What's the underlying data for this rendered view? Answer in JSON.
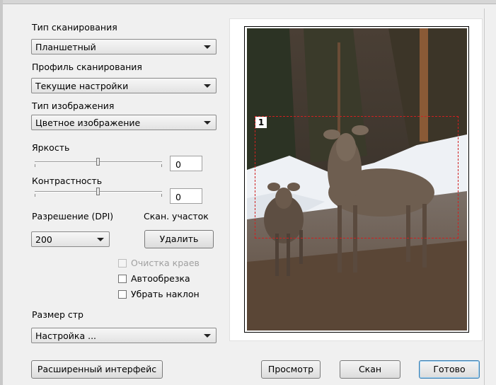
{
  "scan_type": {
    "label": "Тип сканирования",
    "value": "Планшетный"
  },
  "scan_profile": {
    "label": "Профиль сканирования",
    "value": "Текущие настройки"
  },
  "image_type": {
    "label": "Тип изображения",
    "value": "Цветное изображение"
  },
  "brightness": {
    "label": "Яркость",
    "value": "0"
  },
  "contrast": {
    "label": "Контрастность",
    "value": "0"
  },
  "resolution": {
    "label": "Разрешение (DPI)",
    "value": "200"
  },
  "scan_area": {
    "label": "Скан. участок",
    "delete_button": "Удалить"
  },
  "options": {
    "edge_cleanup": {
      "label": "Очистка краев",
      "enabled": false,
      "checked": false
    },
    "auto_crop": {
      "label": "Автообрезка",
      "enabled": true,
      "checked": false
    },
    "deskew": {
      "label": "Убрать наклон",
      "enabled": true,
      "checked": false
    }
  },
  "page_size": {
    "label": "Размер стр",
    "value": "Настройка ..."
  },
  "buttons": {
    "advanced": "Расширенный интерфейс",
    "preview": "Просмотр",
    "scan": "Скан",
    "done": "Готово"
  },
  "preview": {
    "region_number": "1"
  },
  "colors": {
    "selection": "#d02020",
    "default_button_border": "#3c7fb1"
  }
}
